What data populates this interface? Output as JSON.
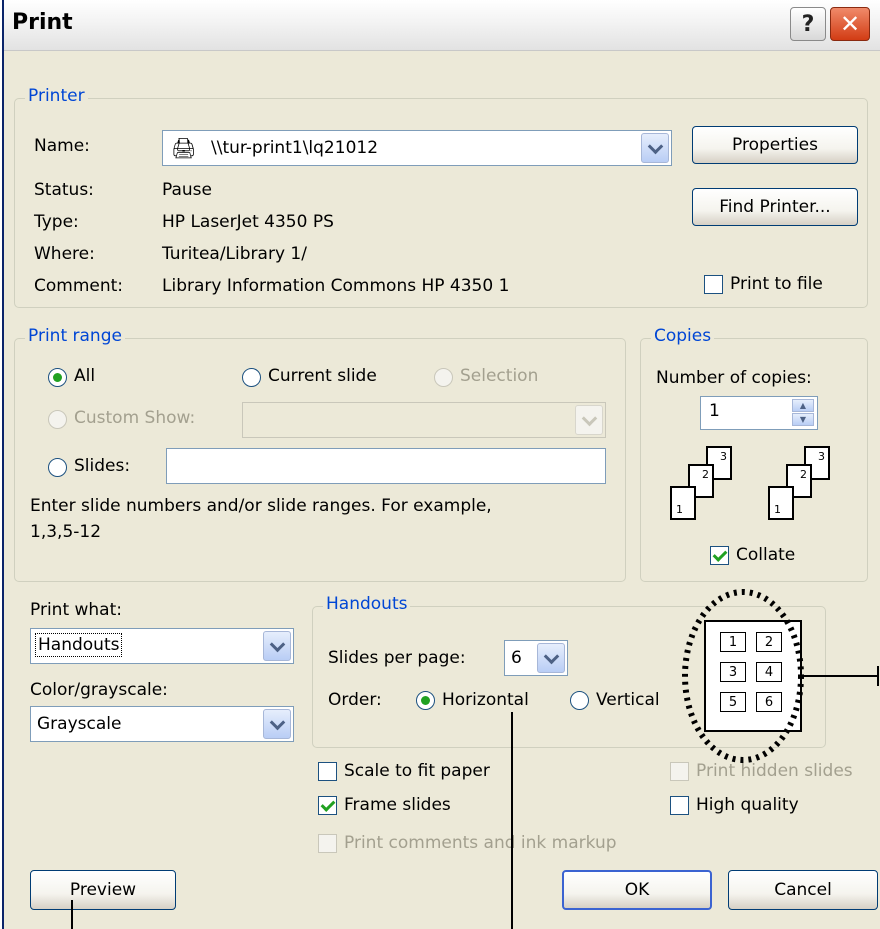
{
  "window": {
    "title": "Print"
  },
  "printer": {
    "group_label": "Printer",
    "name_label": "Name:",
    "name_value": "\\\\tur-print1\\lq21012",
    "status_label": "Status:",
    "status_value": "Pause",
    "type_label": "Type:",
    "type_value": "HP LaserJet 4350 PS",
    "where_label": "Where:",
    "where_value": "Turitea/Library 1/",
    "comment_label": "Comment:",
    "comment_value": "Library Information Commons HP 4350 1",
    "properties_button": "Properties",
    "find_printer_button": "Find Printer...",
    "print_to_file": "Print to file"
  },
  "print_range": {
    "group_label": "Print range",
    "all": "All",
    "current_slide": "Current slide",
    "selection": "Selection",
    "custom_show": "Custom Show:",
    "slides": "Slides:",
    "hint_line1": "Enter slide numbers and/or slide ranges. For example,",
    "hint_line2": "1,3,5-12"
  },
  "copies": {
    "group_label": "Copies",
    "number_label": "Number of copies:",
    "number_value": "1",
    "collate": "Collate",
    "collate_checked": true
  },
  "print_what": {
    "label": "Print what:",
    "value": "Handouts"
  },
  "color": {
    "label": "Color/grayscale:",
    "value": "Grayscale"
  },
  "handouts": {
    "group_label": "Handouts",
    "slides_per_page_label": "Slides per page:",
    "slides_per_page_value": "6",
    "order_label": "Order:",
    "horizontal": "Horizontal",
    "vertical": "Vertical",
    "preview_numbers": [
      "1",
      "2",
      "3",
      "4",
      "5",
      "6"
    ]
  },
  "options": {
    "scale_to_fit": "Scale to fit paper",
    "frame_slides": "Frame slides",
    "print_comments": "Print comments and ink markup",
    "print_hidden": "Print hidden slides",
    "high_quality": "High quality"
  },
  "buttons": {
    "preview": "Preview",
    "ok": "OK",
    "cancel": "Cancel"
  }
}
